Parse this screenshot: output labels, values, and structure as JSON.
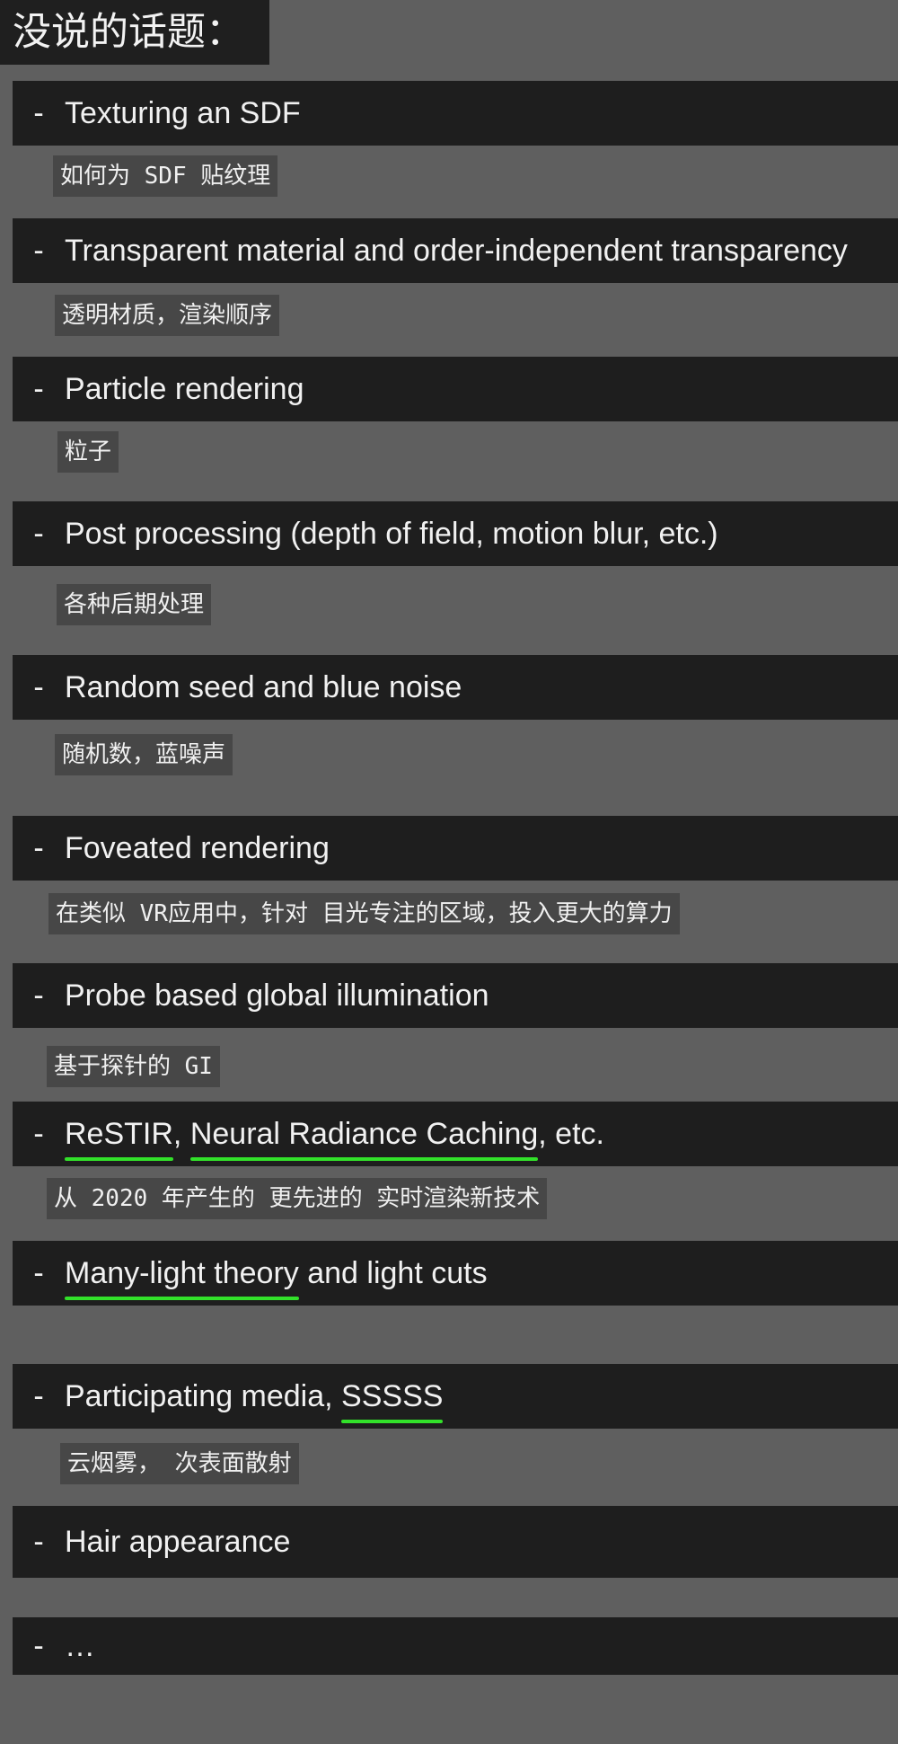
{
  "page_title": "没说的话题：",
  "items": [
    {
      "dash": "-",
      "before": "Texturing an SDF",
      "note": "如何为 SDF 贴纹理"
    },
    {
      "dash": "-",
      "before": "Transparent material and order-independent transparency",
      "note": "透明材质，渲染顺序"
    },
    {
      "dash": "-",
      "before": "Particle rendering",
      "note": "粒子"
    },
    {
      "dash": "-",
      "before": "Post processing (depth of field, motion blur, etc.)",
      "note": "各种后期处理"
    },
    {
      "dash": "-",
      "before": "Random seed and blue noise",
      "note": "随机数，蓝噪声"
    },
    {
      "dash": "-",
      "before": "Foveated rendering",
      "note": "在类似 VR应用中，针对 目光专注的区域，投入更大的算力"
    },
    {
      "dash": "-",
      "before": "Probe based global illumination",
      "note": "基于探针的 GI"
    },
    {
      "dash": "-",
      "u1": "ReSTIR",
      "mid": ", ",
      "u2": "Neural Radiance Caching",
      "after": ", etc.",
      "note": "从 2020 年产生的 更先进的 实时渲染新技术"
    },
    {
      "dash": "-",
      "u1": "Many-light theory",
      "after": " and light cuts"
    },
    {
      "dash": "-",
      "before": "Participating media, ",
      "u1": "SSSSS",
      "note": "云烟雾， 次表面散射"
    },
    {
      "dash": "-",
      "before": "Hair appearance"
    },
    {
      "dash": "-",
      "before": "…"
    }
  ],
  "highlight_color": "#32e12a"
}
